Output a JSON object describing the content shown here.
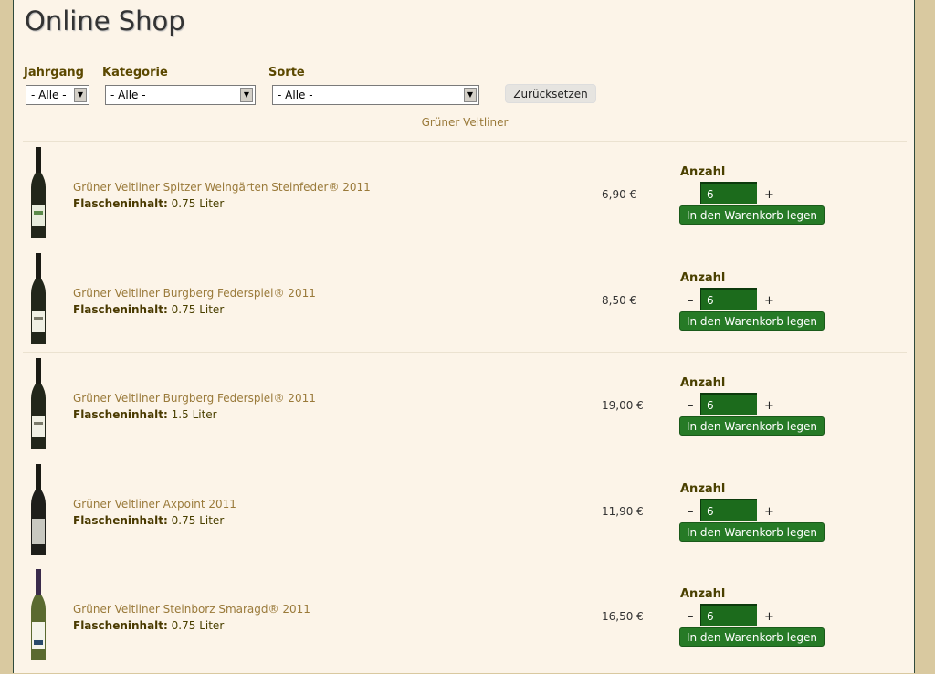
{
  "page_title": "Online Shop",
  "filters": {
    "jahrgang": {
      "label": "Jahrgang",
      "value": "- Alle -"
    },
    "kategorie": {
      "label": "Kategorie",
      "value": "- Alle -"
    },
    "sorte": {
      "label": "Sorte",
      "value": "- Alle -"
    },
    "reset_label": "Zurücksetzen"
  },
  "category_heading": "Grüner Veltliner",
  "common": {
    "content_label": "Flascheninhalt:",
    "qty_label": "Anzahl",
    "minus": "–",
    "plus": "+",
    "cart_button": "In den Warenkorb legen"
  },
  "products": [
    {
      "name": "Grüner Veltliner Spitzer Weingärten Steinfeder® 2011",
      "content": "0.75 Liter",
      "price": "6,90 €",
      "qty": "6"
    },
    {
      "name": "Grüner Veltliner Burgberg Federspiel® 2011",
      "content": "0.75 Liter",
      "price": "8,50 €",
      "qty": "6"
    },
    {
      "name": "Grüner Veltliner Burgberg Federspiel® 2011",
      "content": "1.5 Liter",
      "price": "19,00 €",
      "qty": "6"
    },
    {
      "name": "Grüner Veltliner Axpoint 2011",
      "content": "0.75 Liter",
      "price": "11,90 €",
      "qty": "6"
    },
    {
      "name": "Grüner Veltliner Steinborz Smaragd® 2011",
      "content": "0.75 Liter",
      "price": "16,50 €",
      "qty": "6"
    }
  ]
}
